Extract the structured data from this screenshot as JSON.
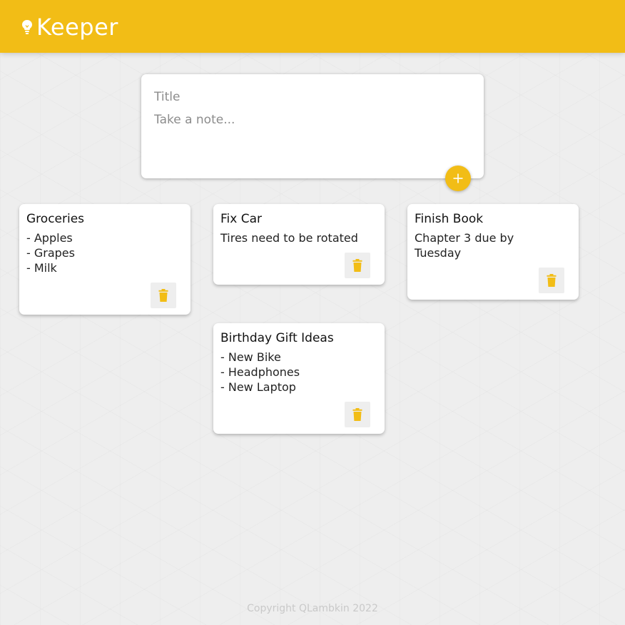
{
  "header": {
    "title": "Keeper",
    "icon": "lightbulb-icon",
    "background_color": "#f2bd16"
  },
  "create_area": {
    "title_placeholder": "Title",
    "content_placeholder": "Take a note...",
    "add_icon": "plus-icon"
  },
  "notes": [
    {
      "title": "Groceries",
      "content": "- Apples\n- Grapes\n- Milk",
      "delete_icon": "trash-icon"
    },
    {
      "title": "Fix Car",
      "content": "Tires need to be rotated",
      "delete_icon": "trash-icon"
    },
    {
      "title": "Finish Book",
      "content": "Chapter 3 due by\nTuesday",
      "delete_icon": "trash-icon"
    },
    {
      "title": "Birthday Gift Ideas",
      "content": "- New Bike\n- Headphones\n- New Laptop",
      "delete_icon": "trash-icon"
    }
  ],
  "footer": {
    "text": "Copyright QLambkin 2022"
  },
  "colors": {
    "accent": "#f2bd16",
    "background": "#eeeeee",
    "card": "#ffffff"
  }
}
